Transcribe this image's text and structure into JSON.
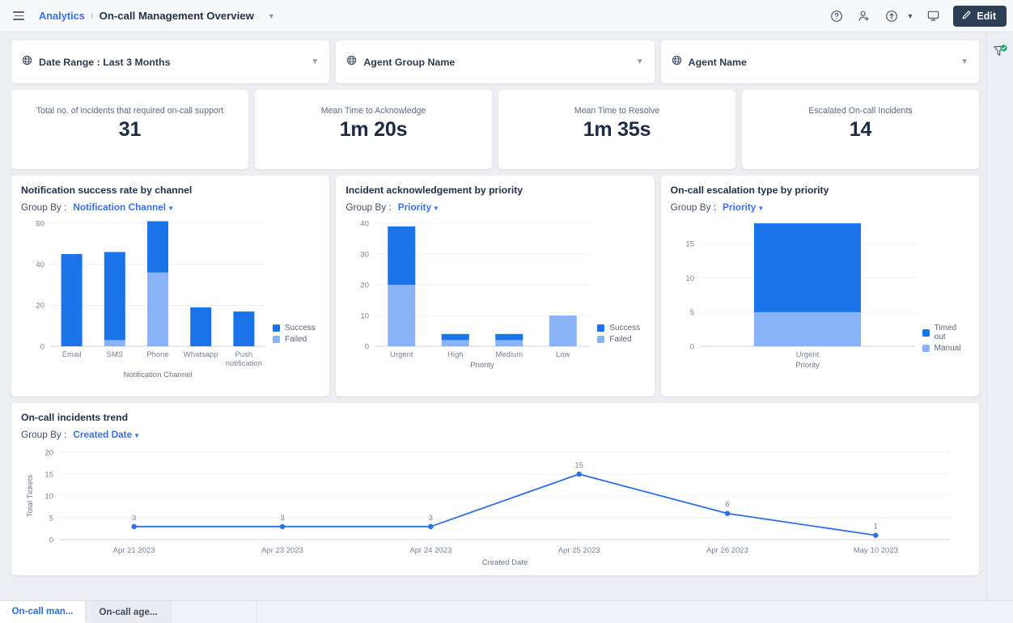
{
  "topbar": {
    "menu_icon": "hamburger-icon",
    "breadcrumb_root": "Analytics",
    "breadcrumb_sep": "›",
    "breadcrumb_current": "On-call Management Overview",
    "icons": [
      "help-circle-icon",
      "add-user-icon",
      "share-upload-icon",
      "monitor-icon"
    ],
    "edit_label": "Edit"
  },
  "rail": {
    "icon": "filter-applied-icon"
  },
  "filters": [
    {
      "label": "Date Range :",
      "value": "Last 3 Months",
      "icon": "globe-icon"
    },
    {
      "label": "Agent Group Name",
      "value": "",
      "icon": "globe-icon"
    },
    {
      "label": "Agent Name",
      "value": "",
      "icon": "globe-icon"
    }
  ],
  "kpis": [
    {
      "label": "Total no. of incidents that required on-call support",
      "value": "31"
    },
    {
      "label": "Mean Time to Acknowledge",
      "value": "1m 20s"
    },
    {
      "label": "Mean Time to Resolve",
      "value": "1m 35s"
    },
    {
      "label": "Escalated On-call Incidents",
      "value": "14"
    }
  ],
  "group_by_label": "Group By :",
  "colors": {
    "series_dark": "#1a73e8",
    "series_light": "#8ab4f8",
    "line": "#2f6fe0",
    "accent": "#3b71e8",
    "edit_bg": "#2c3e55",
    "page_bg": "#eceef2"
  },
  "charts": [
    {
      "title": "Notification success rate by channel",
      "group_by": "Notification Channel"
    },
    {
      "title": "Incident acknowledgement by priority",
      "group_by": "Priority"
    },
    {
      "title": "On-call escalation type by priority",
      "group_by": "Priority"
    },
    {
      "title": "On-call incidents trend",
      "group_by": "Created Date"
    }
  ],
  "chart_data": [
    {
      "type": "bar",
      "stacked": true,
      "title": "Notification success rate by channel",
      "categories": [
        "Email",
        "SMS",
        "Phone",
        "Whatsapp",
        "Push notification"
      ],
      "series": [
        {
          "name": "Failed",
          "values": [
            0,
            3,
            36,
            0,
            0
          ]
        },
        {
          "name": "Success",
          "values": [
            45,
            43,
            25,
            19,
            17
          ]
        }
      ],
      "xlabel": "Notification Channel",
      "ylabel": "",
      "ylim": [
        0,
        60
      ],
      "yticks": [
        0,
        20,
        40,
        60
      ],
      "grid": true,
      "legend": [
        "Success",
        "Failed"
      ],
      "legend_position": "right"
    },
    {
      "type": "bar",
      "stacked": true,
      "title": "Incident acknowledgement by priority",
      "categories": [
        "Urgent",
        "High",
        "Medium",
        "Low"
      ],
      "series": [
        {
          "name": "Failed",
          "values": [
            20,
            2,
            2,
            10
          ]
        },
        {
          "name": "Success",
          "values": [
            19,
            2,
            2,
            0
          ]
        }
      ],
      "xlabel": "Priority",
      "ylabel": "",
      "ylim": [
        0,
        40
      ],
      "yticks": [
        0,
        10,
        20,
        30,
        40
      ],
      "grid": true,
      "legend": [
        "Success",
        "Failed"
      ],
      "legend_position": "right"
    },
    {
      "type": "bar",
      "stacked": true,
      "title": "On-call escalation type by priority",
      "categories": [
        "Urgent"
      ],
      "series": [
        {
          "name": "Manual",
          "values": [
            5
          ]
        },
        {
          "name": "Timed out",
          "values": [
            13
          ]
        }
      ],
      "xlabel": "Priority",
      "ylabel": "",
      "ylim": [
        0,
        18
      ],
      "yticks": [
        0,
        5,
        10,
        15
      ],
      "grid": true,
      "legend": [
        "Timed out",
        "Manual"
      ],
      "legend_position": "right"
    },
    {
      "type": "line",
      "title": "On-call incidents trend",
      "x": [
        "Apr 21 2023",
        "Apr 23 2023",
        "Apr 24 2023",
        "Apr 25 2023",
        "Apr 26 2023",
        "May 10 2023"
      ],
      "values": [
        3,
        3,
        3,
        15,
        6,
        1
      ],
      "point_labels": [
        "3",
        "3",
        "3",
        "15",
        "6",
        "1"
      ],
      "xlabel": "Created Date",
      "ylabel": "Total Tickets",
      "ylim": [
        0,
        20
      ],
      "yticks": [
        0,
        5,
        10,
        15,
        20
      ],
      "grid": true,
      "markers": true
    }
  ],
  "tabs": [
    {
      "label": "On-call man...",
      "active": true
    },
    {
      "label": "On-call age...",
      "active": false
    }
  ]
}
